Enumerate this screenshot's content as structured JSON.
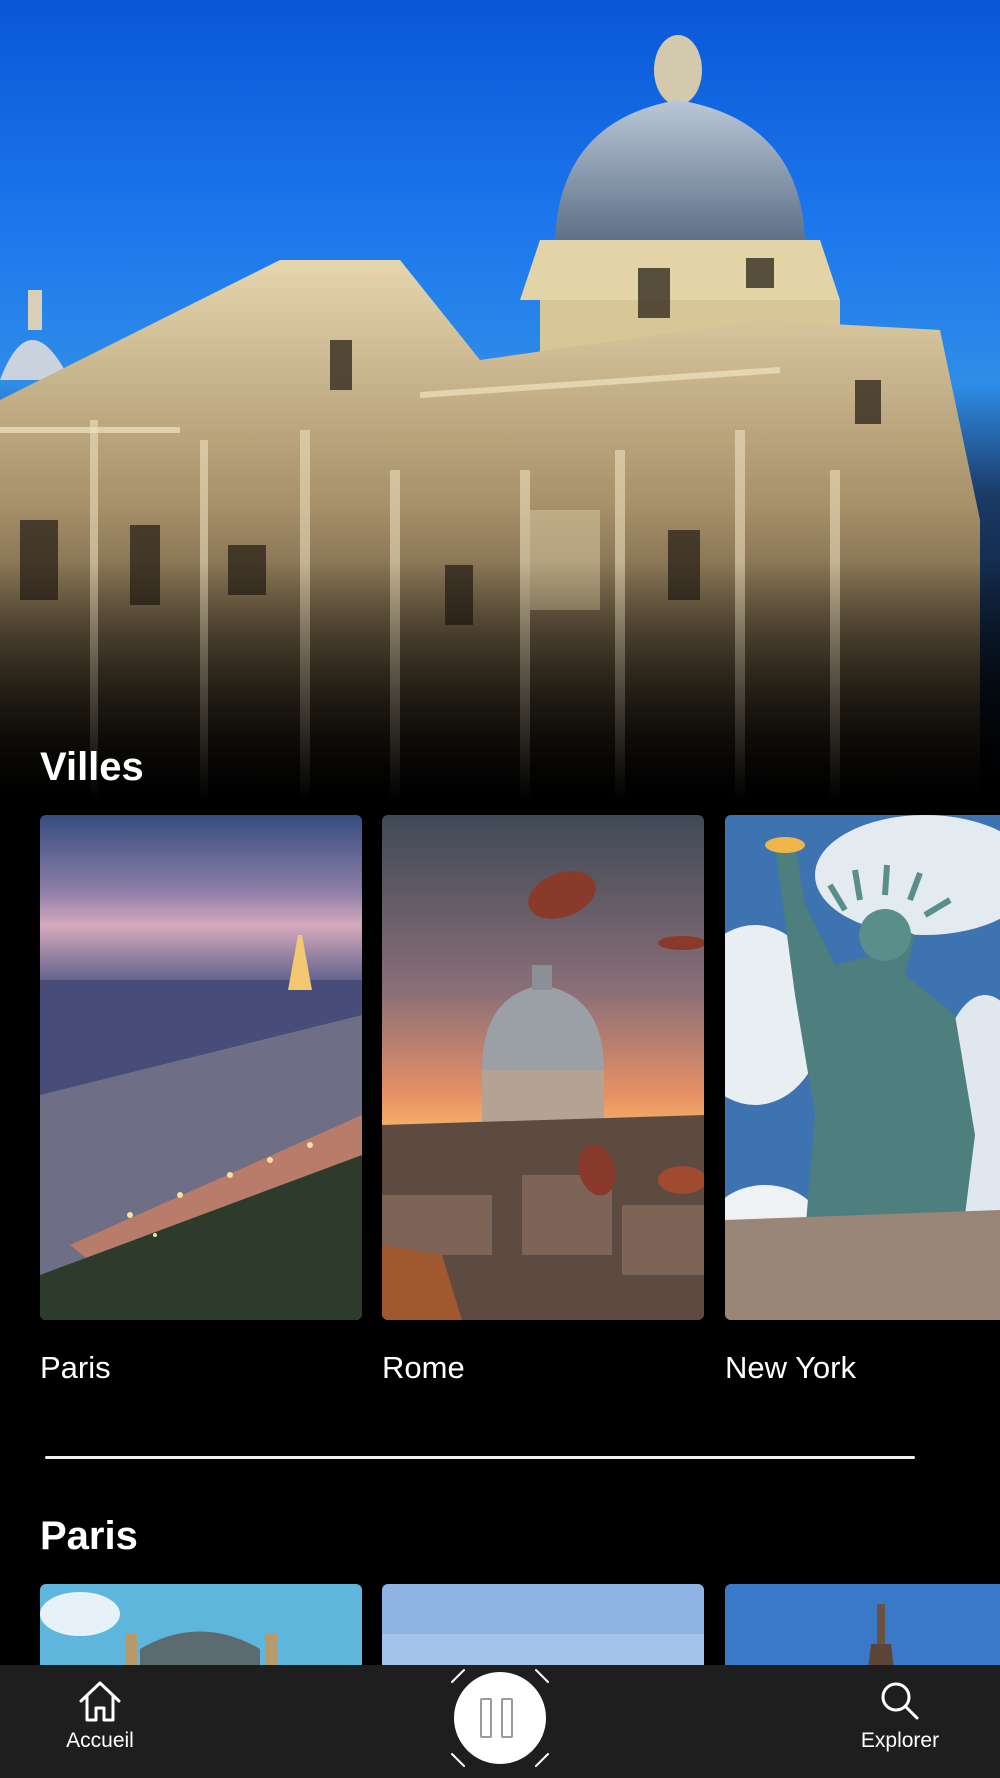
{
  "sections": {
    "cities_title": "Villes",
    "paris_title": "Paris"
  },
  "cities": [
    {
      "name": "Paris",
      "image_icon": "paris-skyline-image"
    },
    {
      "name": "Rome",
      "image_icon": "rome-dome-image"
    },
    {
      "name": "New York",
      "image_icon": "statue-of-liberty-image"
    }
  ],
  "paris_places": [
    {
      "image_icon": "palace-image"
    },
    {
      "image_icon": "sky-image"
    },
    {
      "image_icon": "eiffel-tower-image"
    }
  ],
  "tabbar": {
    "home_label": "Accueil",
    "home_icon": "home-icon",
    "center_icon": "pause-icon",
    "explore_label": "Explorer",
    "explore_icon": "search-icon"
  },
  "colors": {
    "background": "#000000",
    "tabbar": "#1e1e1e",
    "text": "#ffffff",
    "hero_sky": "#1c77ec"
  }
}
